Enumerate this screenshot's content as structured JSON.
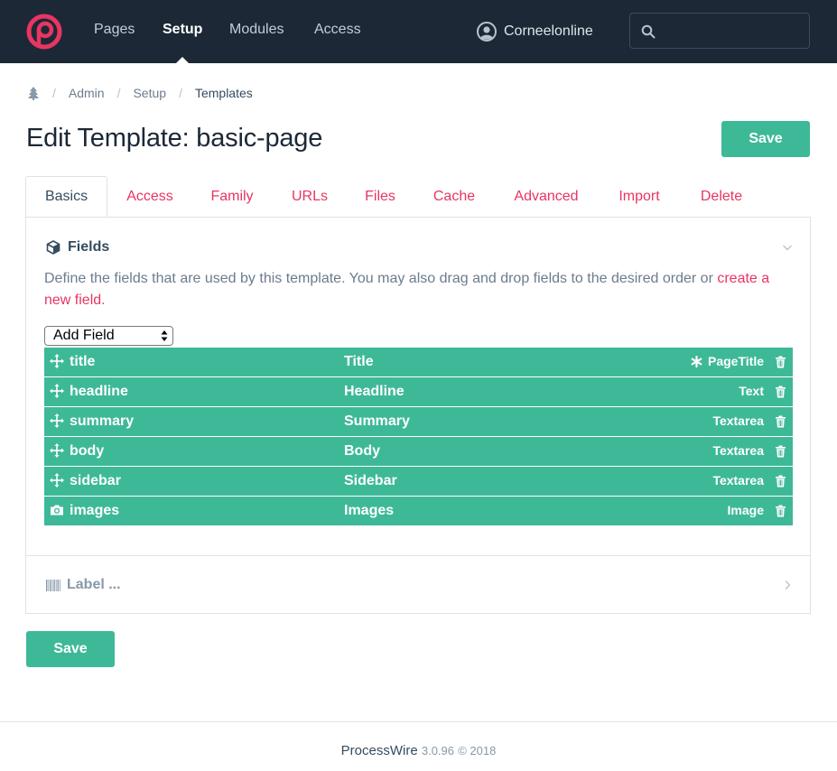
{
  "topbar": {
    "nav": [
      {
        "label": "Pages",
        "active": false
      },
      {
        "label": "Setup",
        "active": true
      },
      {
        "label": "Modules",
        "active": false
      },
      {
        "label": "Access",
        "active": false
      }
    ],
    "user_name": "Corneelonline",
    "search_placeholder": "",
    "logo_color": "#e83561"
  },
  "breadcrumb": {
    "items": [
      "Admin",
      "Setup",
      "Templates"
    ]
  },
  "page": {
    "title": "Edit Template: basic-page",
    "save_label": "Save",
    "bottom_save_label": "Save"
  },
  "tabs": [
    "Basics",
    "Access",
    "Family",
    "URLs",
    "Files",
    "Cache",
    "Advanced",
    "Import",
    "Delete"
  ],
  "fields_section": {
    "heading": "Fields",
    "description": "Define the fields that are used by this template. You may also drag and drop fields to the desired order or",
    "link_text": "create a new field.",
    "add_field_label": "Add Field",
    "rows": [
      {
        "name": "title",
        "label": "Title",
        "type": "PageTitle",
        "icon": "move-icon"
      },
      {
        "name": "headline",
        "label": "Headline",
        "type": "Text",
        "icon": "move-icon"
      },
      {
        "name": "summary",
        "label": "Summary",
        "type": "Textarea",
        "icon": "move-icon"
      },
      {
        "name": "body",
        "label": "Body",
        "type": "Textarea",
        "icon": "move-icon"
      },
      {
        "name": "sidebar",
        "label": "Sidebar",
        "type": "Textarea",
        "icon": "move-icon"
      },
      {
        "name": "images",
        "label": "Images",
        "type": "Image",
        "icon": "camera-icon"
      }
    ]
  },
  "label_section": {
    "heading": "Label ..."
  },
  "footer": {
    "brand": "ProcessWire",
    "version": "3.0.96",
    "copyright": "© 2018"
  },
  "colors": {
    "accent_green": "#3eb998",
    "link_red": "#e83561",
    "nav_bg": "#1c2836"
  }
}
